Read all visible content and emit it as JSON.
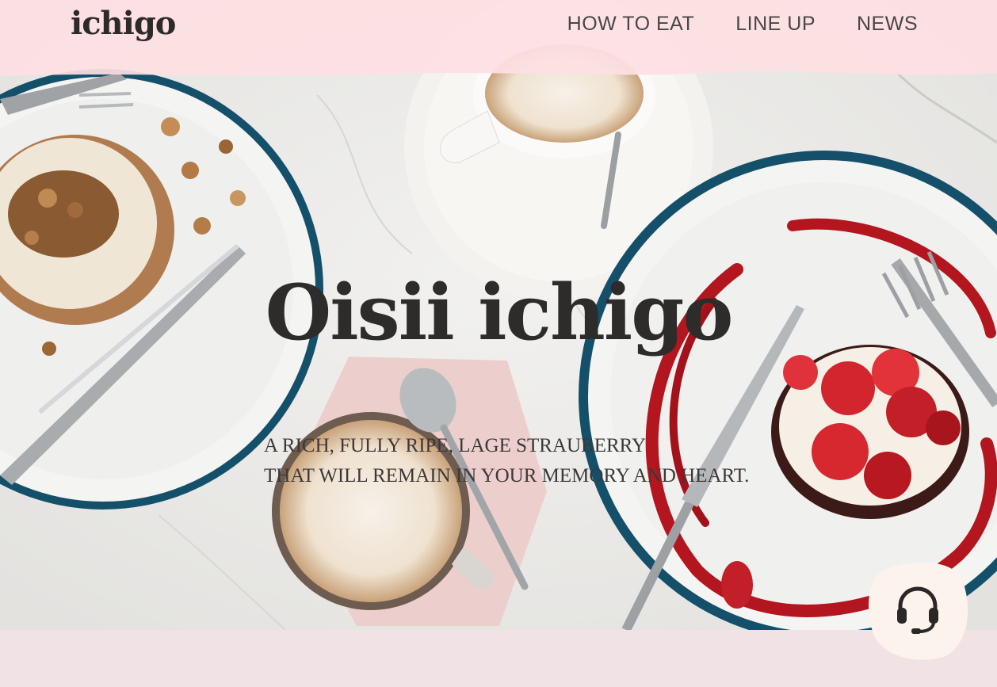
{
  "header": {
    "logo": "ichigo",
    "nav": [
      {
        "label": "HOW TO EAT"
      },
      {
        "label": "LINE UP"
      },
      {
        "label": "NEWS"
      }
    ]
  },
  "hero": {
    "title": "Oisii ichigo",
    "tagline_lines": [
      "A RICH, FULLY RIPE, LAGE STRAUBERRY",
      "THAT WILL REMAIN IN YOUR MEMORY AND HEART."
    ]
  },
  "support": {
    "icon": "headset-icon"
  },
  "colors": {
    "header_pink": "#fde0e3",
    "plate_rim": "#14506a",
    "sauce": "#b3161f",
    "marble": "#ecebe9",
    "support_bg": "#fbf3ec"
  }
}
